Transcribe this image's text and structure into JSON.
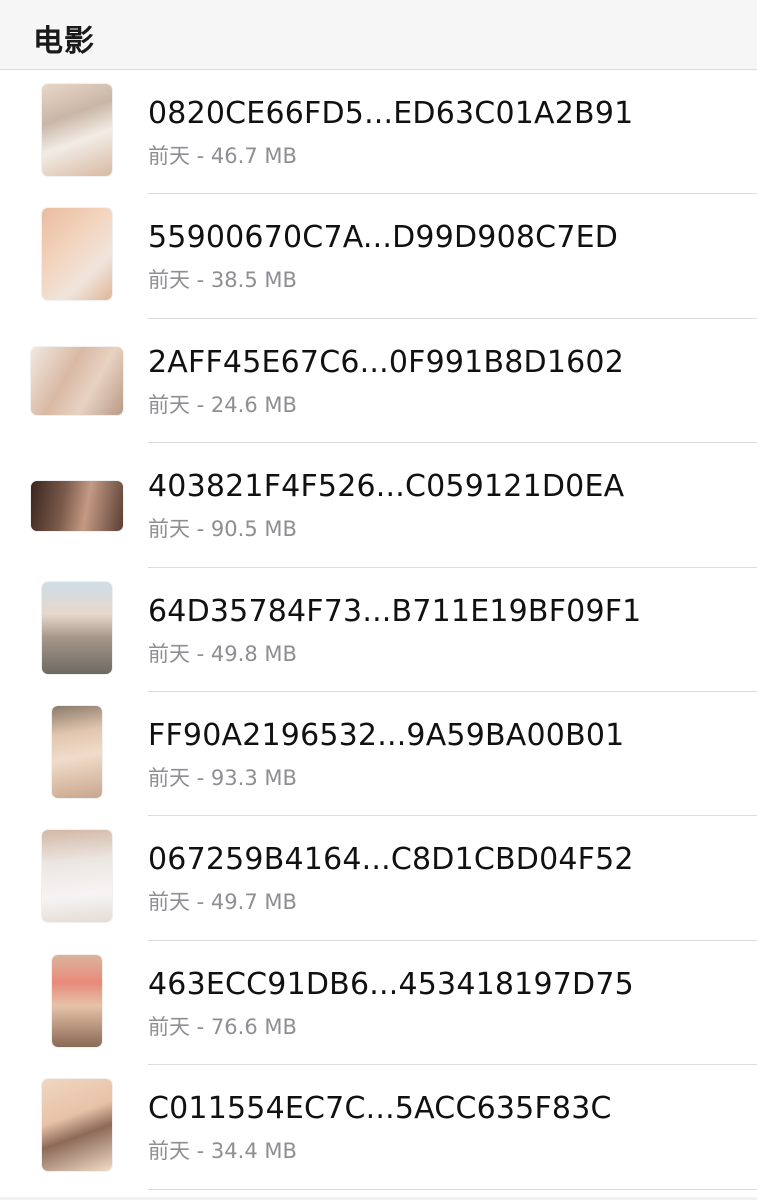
{
  "header": {
    "title": "电影"
  },
  "files": [
    {
      "name": "0820CE66FD5...ED63C01A2B91",
      "meta": "前天 - 46.7 MB"
    },
    {
      "name": "55900670C7A...D99D908C7ED",
      "meta": "前天 - 38.5 MB"
    },
    {
      "name": "2AFF45E67C6...0F991B8D1602",
      "meta": "前天 - 24.6 MB"
    },
    {
      "name": "403821F4F526...C059121D0EA",
      "meta": "前天 - 90.5 MB"
    },
    {
      "name": "64D35784F73...B711E19BF09F1",
      "meta": "前天 - 49.8 MB"
    },
    {
      "name": "FF90A2196532...9A59BA00B01",
      "meta": "前天 - 93.3 MB"
    },
    {
      "name": "067259B4164...C8D1CBD04F52",
      "meta": "前天 - 49.7 MB"
    },
    {
      "name": "463ECC91DB6...453418197D75",
      "meta": "前天 - 76.6 MB"
    },
    {
      "name": "C011554EC7C...5ACC635F83C",
      "meta": "前天 - 34.4 MB"
    }
  ],
  "colors": {
    "header_bg": "#f6f6f6",
    "title_text": "#1a1a1a",
    "meta_text": "#8e8e93",
    "separator": "#dcdcdc"
  }
}
